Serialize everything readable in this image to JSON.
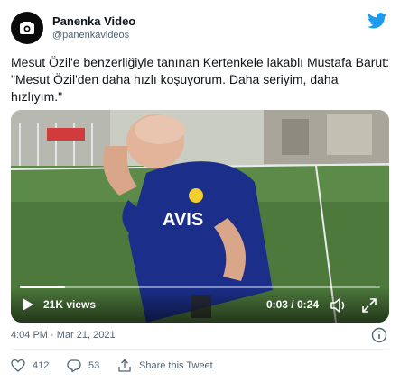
{
  "author": {
    "display_name": "Panenka Video",
    "handle": "@panenkavideos",
    "avatar_icon": "camera-icon"
  },
  "brand_icon": "twitter-bird-icon",
  "tweet": {
    "text": "Mesut Özil'e benzerliğiyle tanınan Kertenkele lakablı Mustafa Barut: \"Mesut Özil'den daha hızlı koşuyorum. Daha seriyim, daha hızlıyım.\""
  },
  "video": {
    "jersey_sponsor": "AVIS",
    "views": "21K views",
    "time": "0:03 / 0:24",
    "progress_fraction": 0.125
  },
  "meta": {
    "timestamp": "4:04 PM · Mar 21, 2021"
  },
  "actions": {
    "likes": "412",
    "replies": "53",
    "share_label": "Share this Tweet"
  },
  "colors": {
    "twitter_blue": "#1d9bf0",
    "muted_text": "#536471"
  }
}
